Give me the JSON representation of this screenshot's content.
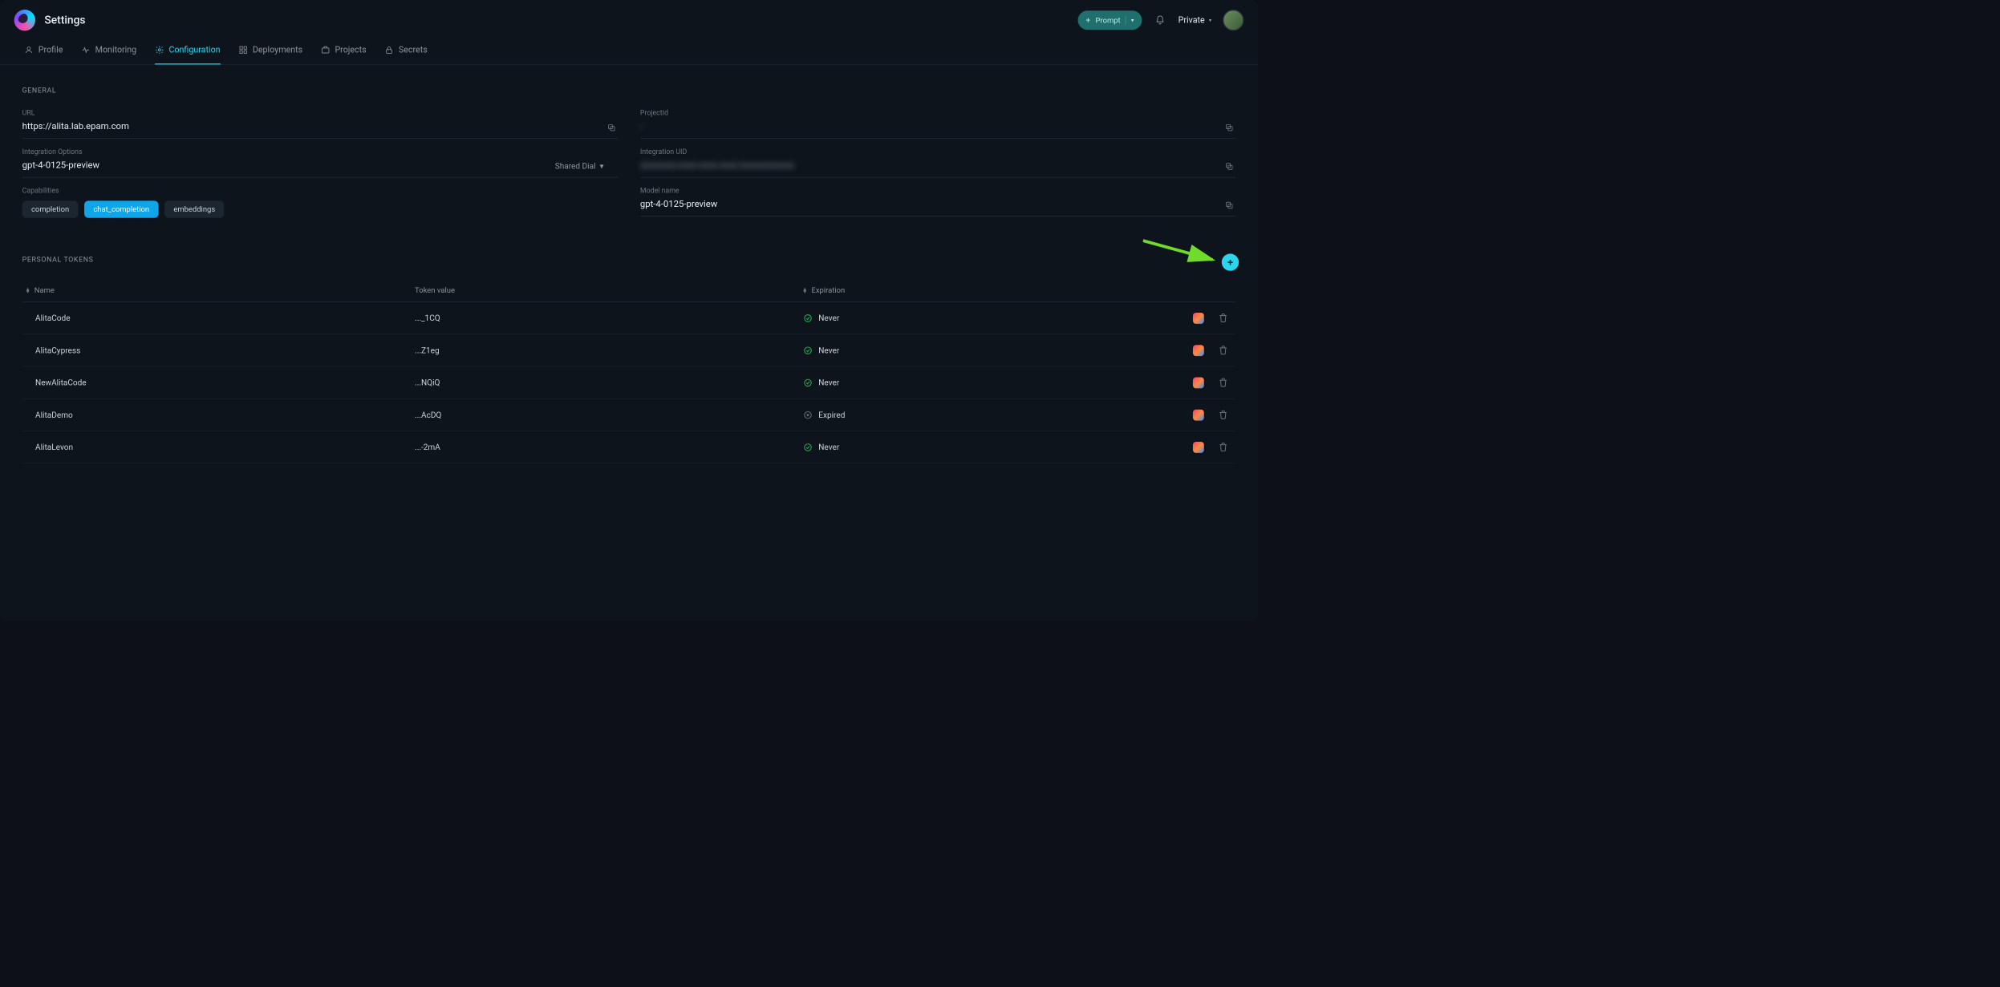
{
  "header": {
    "title": "Settings",
    "prompt_label": "Prompt",
    "workspace_label": "Private"
  },
  "tabs": [
    {
      "id": "profile",
      "label": "Profile"
    },
    {
      "id": "monitoring",
      "label": "Monitoring"
    },
    {
      "id": "configuration",
      "label": "Configuration"
    },
    {
      "id": "deployments",
      "label": "Deployments"
    },
    {
      "id": "projects",
      "label": "Projects"
    },
    {
      "id": "secrets",
      "label": "Secrets"
    }
  ],
  "active_tab": "configuration",
  "sections": {
    "general": {
      "heading": "General",
      "url_label": "URL",
      "url_value": "https://alita.lab.epam.com",
      "projectid_label": "ProjectId",
      "projectid_value": "•",
      "intopts_label": "Integration Options",
      "intopts_value": "gpt-4-0125-preview",
      "shared_dial_label": "Shared Dial",
      "intuid_label": "Integration UID",
      "intuid_value": "xxxxxxxx-xxxx-xxxx-xxxx-xxxxxxxxxxxx",
      "caps_label": "Capabilities",
      "caps": [
        "completion",
        "chat_completion",
        "embeddings"
      ],
      "caps_active": "chat_completion",
      "model_label": "Model name",
      "model_value": "gpt-4-0125-preview"
    },
    "tokens": {
      "heading": "Personal tokens",
      "columns": {
        "name": "Name",
        "value": "Token value",
        "exp": "Expiration"
      },
      "rows": [
        {
          "name": "AlitaCode",
          "value": "..._1CQ",
          "exp": "Never",
          "status": "ok"
        },
        {
          "name": "AlitaCypress",
          "value": "...Z1eg",
          "exp": "Never",
          "status": "ok"
        },
        {
          "name": "NewAlitaCode",
          "value": "...NQiQ",
          "exp": "Never",
          "status": "ok"
        },
        {
          "name": "AlitaDemo",
          "value": "...AcDQ",
          "exp": "Expired",
          "status": "expired"
        },
        {
          "name": "AlitaLevon",
          "value": "...-2mA",
          "exp": "Never",
          "status": "ok"
        }
      ]
    }
  }
}
